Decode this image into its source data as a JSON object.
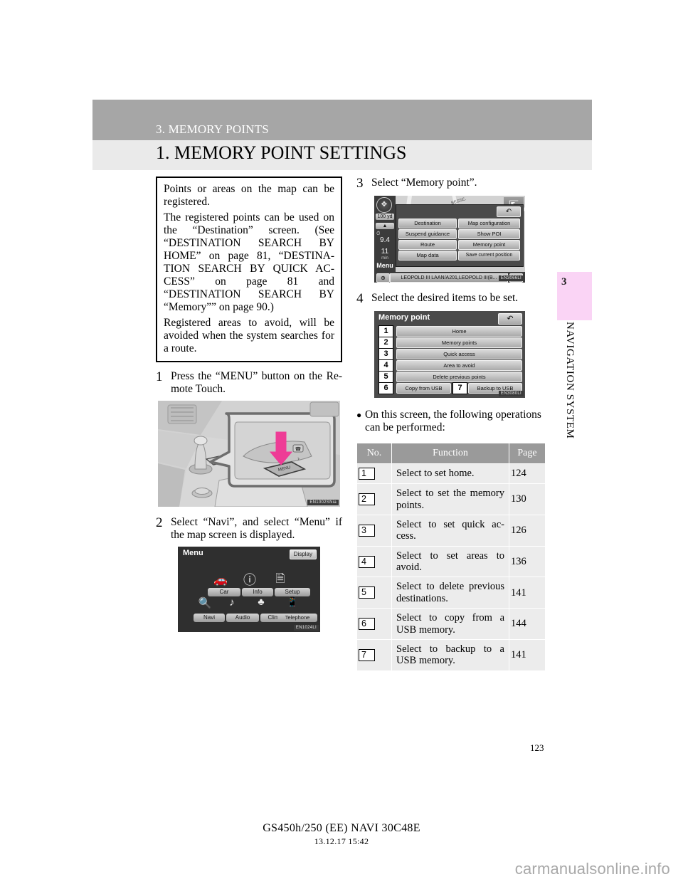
{
  "header": {
    "chapter": "3. MEMORY POINTS",
    "section": "1. MEMORY POINT SETTINGS"
  },
  "side_tab": {
    "number": "3",
    "vertical_label": "NAVIGATION SYSTEM",
    "color": "#fad4f5"
  },
  "note_box": {
    "paragraphs": [
      "Points or areas on the map can be registered.",
      "The registered points can be used on the “Destination” screen. (See “DESTINATION SEARCH BY HOME” on page 81, “DESTINA-TION SEARCH BY QUICK AC-CESS” on page 81 and “DESTINATION SEARCH BY “Memory”” on page 90.)",
      "Registered areas to avoid, will be avoided when the system searches for a route."
    ]
  },
  "steps": {
    "step1": {
      "num": "1",
      "text": "Press the “MENU” button on the Re-mote Touch."
    },
    "step2": {
      "num": "2",
      "text": "Select “Navi”, and select “Menu” if the map screen is displayed."
    },
    "step3": {
      "num": "3",
      "text": "Select “Memory point”."
    },
    "step4": {
      "num": "4",
      "text": "Select the desired items to be set."
    }
  },
  "figures": {
    "console": {
      "caption": "EN1002SNia",
      "button_label": "MENU"
    },
    "menu_screen": {
      "caption": "EN1024LI",
      "title": "Menu",
      "display_button": "Display",
      "tiles_top": [
        "Car",
        "Info",
        "Setup"
      ],
      "tiles_bottom": [
        "Navi",
        "Audio",
        "Climate",
        "Telephone"
      ],
      "icons_top": [
        "car-icon",
        "info-icon",
        "setup-icon"
      ],
      "icons_bottom": [
        "navi-icon",
        "audio-icon",
        "climate-icon",
        "telephone-icon"
      ]
    },
    "nav_screen": {
      "caption": "EN3066LI",
      "back_glyph": "↶",
      "scale_label": "100 yd",
      "eta_distance": "9.4",
      "eta_time": "11",
      "eta_time_unit": "min",
      "menu_label": "Menu",
      "buttons_left": [
        "Destination",
        "Suspend guidance",
        "Route",
        "Map data"
      ],
      "buttons_right": [
        "Map configuration",
        "Show POI",
        "Memory point",
        "Save current position"
      ],
      "street_label": "LEOPOLD III LAAN/A201,LEOPOLD III(B...",
      "zoom_in": "⊕",
      "zoom_out": "⊖",
      "map_label": "BESSE."
    },
    "memory_point_screen": {
      "caption": "EN3080LI",
      "title": "Memory point",
      "back_glyph": "↶",
      "rows": [
        {
          "num": "1",
          "label": "Home"
        },
        {
          "num": "2",
          "label": "Memory points"
        },
        {
          "num": "3",
          "label": "Quick access"
        },
        {
          "num": "4",
          "label": "Area to avoid"
        },
        {
          "num": "5",
          "label": "Delete previous points"
        }
      ],
      "row6": {
        "num": "6",
        "label": "Copy from USB"
      },
      "row7": {
        "num": "7",
        "label": "Backup to USB"
      }
    }
  },
  "bullet": {
    "text": "On this screen, the following operations can be performed:"
  },
  "table": {
    "headers": [
      "No.",
      "Function",
      "Page"
    ],
    "rows": [
      {
        "no": "1",
        "function": "Select to set home.",
        "page": "124"
      },
      {
        "no": "2",
        "function": "Select to set the memory points.",
        "page": "130"
      },
      {
        "no": "3",
        "function": "Select to set quick ac-cess.",
        "page": "126"
      },
      {
        "no": "4",
        "function": "Select to set areas to avoid.",
        "page": "136"
      },
      {
        "no": "5",
        "function": "Select to delete previous destinations.",
        "page": "141"
      },
      {
        "no": "6",
        "function": "Select to copy from a USB memory.",
        "page": "144"
      },
      {
        "no": "7",
        "function": "Select to backup to a USB memory.",
        "page": "141"
      }
    ]
  },
  "page_number": "123",
  "doc_footer": {
    "line1": "GS450h/250 (EE)  NAVI   30C48E",
    "line2": "13.12.17     15:42"
  },
  "watermark": "carmanualsonline.info"
}
